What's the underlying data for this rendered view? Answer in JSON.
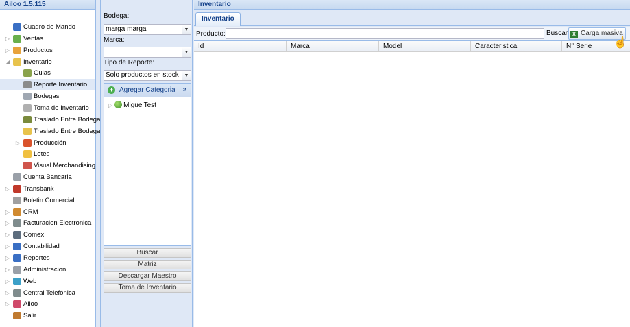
{
  "app": {
    "title": "Ailoo 1.5.115"
  },
  "nav": {
    "items": [
      {
        "label": "Cuadro de Mando",
        "icon": "bar-chart-icon",
        "level": 0,
        "expander": false
      },
      {
        "label": "Ventas",
        "icon": "money-icon",
        "level": 0,
        "expander": true
      },
      {
        "label": "Productos",
        "icon": "box-icon",
        "level": 0,
        "expander": true
      },
      {
        "label": "Inventario",
        "icon": "package-icon",
        "level": 0,
        "expander": true,
        "expanded": true
      },
      {
        "label": "Guias",
        "icon": "guide-icon",
        "level": 1,
        "expander": false
      },
      {
        "label": "Reporte Inventario",
        "icon": "report-icon",
        "level": 1,
        "expander": false,
        "selected": true
      },
      {
        "label": "Bodegas",
        "icon": "warehouse-icon",
        "level": 1,
        "expander": false
      },
      {
        "label": "Toma de Inventario",
        "icon": "document-icon",
        "level": 1,
        "expander": false
      },
      {
        "label": "Traslado Entre Bodegas",
        "icon": "truck-icon",
        "level": 1,
        "expander": false
      },
      {
        "label": "Traslado Entre Bodegas",
        "icon": "folder-icon",
        "level": 1,
        "expander": false
      },
      {
        "label": "Producción",
        "icon": "factory-icon",
        "level": 1,
        "expander": true
      },
      {
        "label": "Lotes",
        "icon": "boxes-icon",
        "level": 1,
        "expander": false
      },
      {
        "label": "Visual Merchandising",
        "icon": "shapes-icon",
        "level": 1,
        "expander": false
      },
      {
        "label": "Cuenta Bancaria",
        "icon": "bank-icon",
        "level": 0,
        "expander": false
      },
      {
        "label": "Transbank",
        "icon": "transbank-icon",
        "level": 0,
        "expander": true
      },
      {
        "label": "Boletin Comercial",
        "icon": "tag-icon",
        "level": 0,
        "expander": false
      },
      {
        "label": "CRM",
        "icon": "users-icon",
        "level": 0,
        "expander": true
      },
      {
        "label": "Facturacion Electronica",
        "icon": "invoice-icon",
        "level": 0,
        "expander": true
      },
      {
        "label": "Comex",
        "icon": "ship-icon",
        "level": 0,
        "expander": true
      },
      {
        "label": "Contabilidad",
        "icon": "ledger-icon",
        "level": 0,
        "expander": true
      },
      {
        "label": "Reportes",
        "icon": "bar-chart-icon",
        "level": 0,
        "expander": true
      },
      {
        "label": "Administracion",
        "icon": "gear-icon",
        "level": 0,
        "expander": true
      },
      {
        "label": "Web",
        "icon": "globe-icon",
        "level": 0,
        "expander": true
      },
      {
        "label": "Central Telefónica",
        "icon": "phone-icon",
        "level": 0,
        "expander": true
      },
      {
        "label": "Ailoo",
        "icon": "flower-icon",
        "level": 0,
        "expander": true
      },
      {
        "label": "Salir",
        "icon": "exit-icon",
        "level": 0,
        "expander": false
      }
    ]
  },
  "filter": {
    "bodega_label": "Bodega:",
    "bodega_value": "marga marga",
    "marca_label": "Marca:",
    "marca_value": "",
    "tipo_label": "Tipo de Reporte:",
    "tipo_value": "Solo productos en stock",
    "add_category_label": "Agregar Categoria",
    "more_label": "»",
    "category_node": "MiguelTest",
    "buttons": {
      "buscar": "Buscar",
      "matriz": "Matriz",
      "descargar": "Descargar Maestro",
      "toma": "Toma de Inventario"
    }
  },
  "main": {
    "header": "Inventario",
    "tab_label": "Inventario",
    "producto_label": "Producto:",
    "producto_value": "",
    "buscar_label": "Buscar",
    "carga_label": "Carga masiva",
    "columns": [
      "Id",
      "Marca",
      "Model",
      "Caracteristica",
      "N° Serie"
    ]
  },
  "colors": {
    "header_text": "#15428b",
    "panel_bg": "#dfe8f6",
    "border": "#99bbe8"
  }
}
